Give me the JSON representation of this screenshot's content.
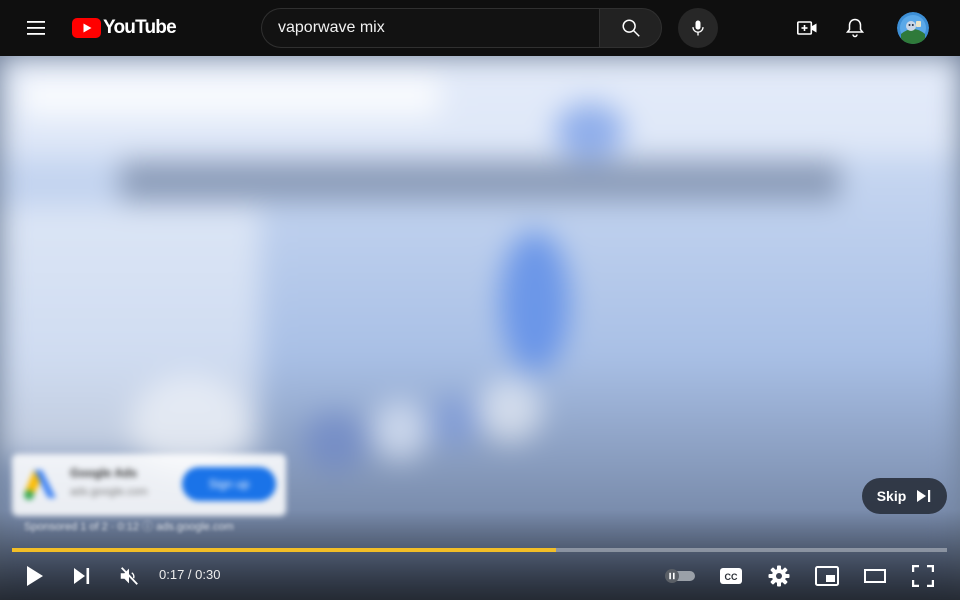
{
  "header": {
    "logo_text": "YouTube",
    "search": {
      "value": "vaporwave mix"
    },
    "icons": {
      "menu": "hamburger-menu-icon",
      "search": "search-icon",
      "mic": "microphone-icon",
      "create": "create-video-icon",
      "notifications": "bell-icon",
      "avatar": "user-avatar"
    }
  },
  "player": {
    "ad": {
      "advertiser": "Google Ads",
      "domain": "ads.google.com",
      "cta_label": "Sign up",
      "info_line": "Sponsored 1 of 2 · 0:12  ⓘ  ads.google.com"
    },
    "skip_label": "Skip",
    "time_display": "0:17 / 0:30",
    "progress_fraction": 0.582,
    "colors": {
      "progress": "#f2be27",
      "skip_bg": "#262c38"
    },
    "controls": [
      "play-icon",
      "next-icon",
      "volume-muted-icon",
      "autoplay-toggle",
      "captions-icon",
      "settings-gear-icon",
      "miniplayer-icon",
      "theater-mode-icon",
      "fullscreen-icon"
    ]
  }
}
